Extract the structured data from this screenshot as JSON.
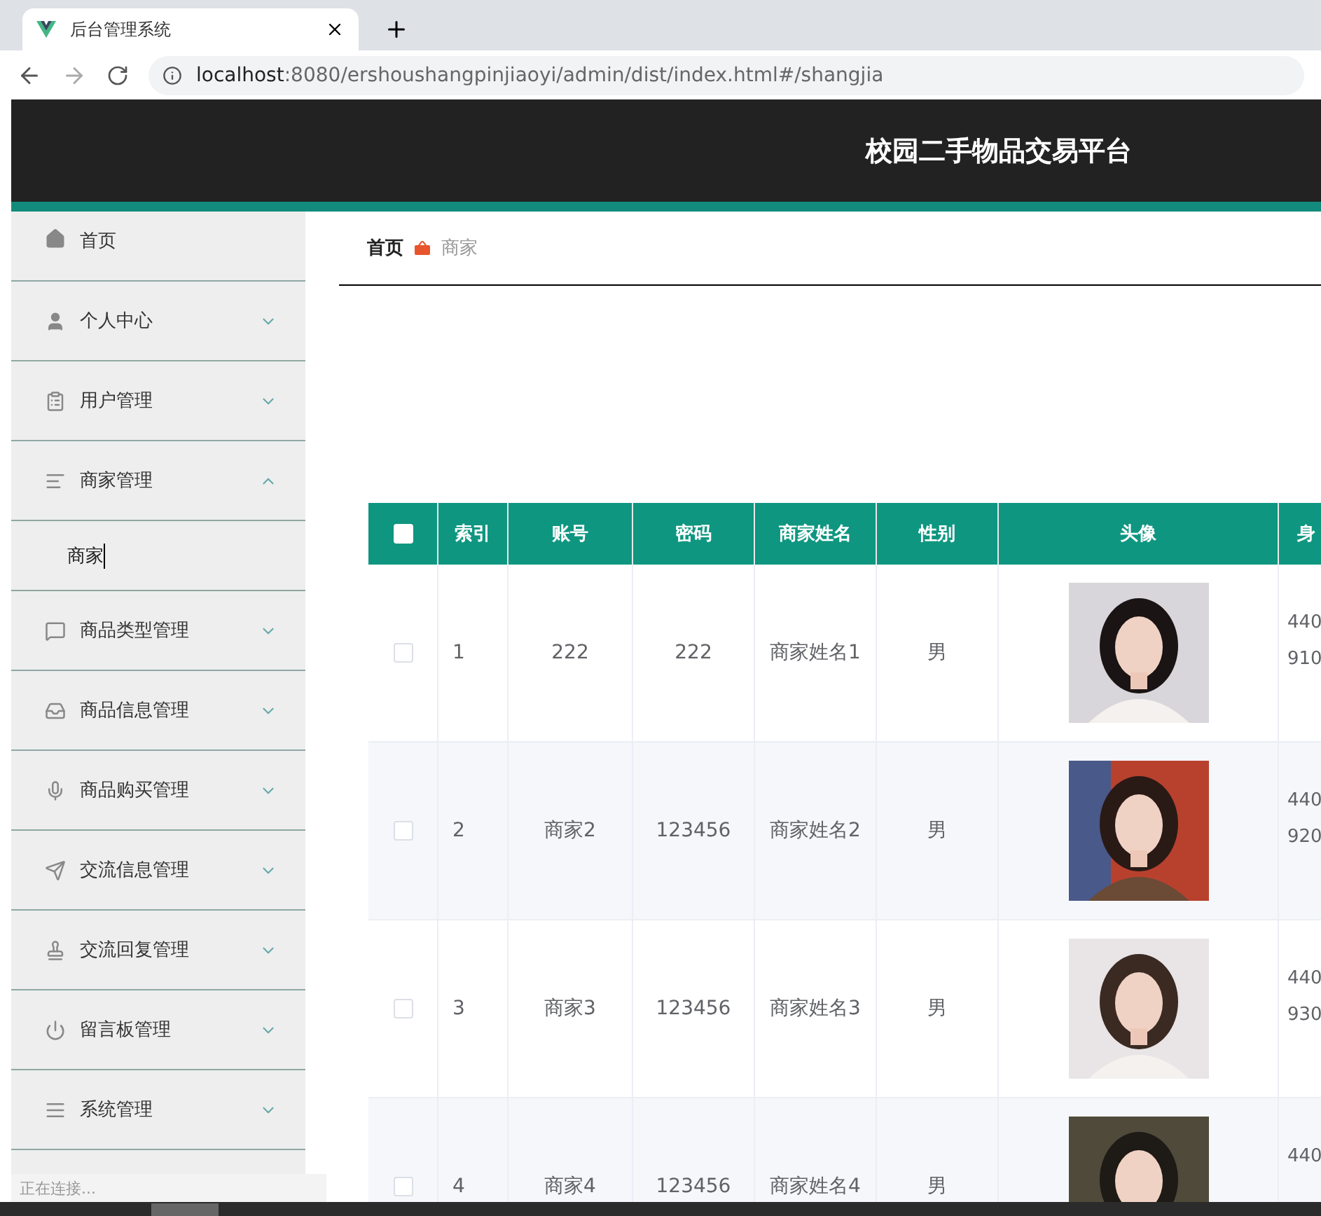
{
  "browser": {
    "tab_title": "后台管理系统",
    "url_host": "localhost",
    "url_rest": ":8080/ershoushangpinjiaoyi/admin/dist/index.html#/shangjia"
  },
  "header": {
    "title": "校园二手物品交易平台"
  },
  "sidebar": {
    "items": [
      {
        "label": "首页"
      },
      {
        "label": "个人中心",
        "expanded": false
      },
      {
        "label": "用户管理",
        "expanded": false
      },
      {
        "label": "商家管理",
        "expanded": true,
        "children": [
          {
            "label": "商家"
          }
        ]
      },
      {
        "label": "商品类型管理",
        "expanded": false
      },
      {
        "label": "商品信息管理",
        "expanded": false
      },
      {
        "label": "商品购买管理",
        "expanded": false
      },
      {
        "label": "交流信息管理",
        "expanded": false
      },
      {
        "label": "交流回复管理",
        "expanded": false
      },
      {
        "label": "留言板管理",
        "expanded": false
      },
      {
        "label": "系统管理",
        "expanded": false
      }
    ]
  },
  "breadcrumb": [
    "首页",
    "商家"
  ],
  "table": {
    "select_all": {
      "checked": false
    },
    "columns": [
      "索引",
      "账号",
      "密码",
      "商家姓名",
      "性别",
      "头像",
      "身"
    ],
    "rows": [
      {
        "cells": [
          "1",
          "222",
          "222",
          "商家姓名1",
          "男"
        ],
        "avatar": {
          "kind": "picture"
        },
        "column_7": [
          "440",
          "910"
        ],
        "checked": false
      },
      {
        "cells": [
          "2",
          "商家2",
          "123456",
          "商家姓名2",
          "男"
        ],
        "avatar": {
          "kind": "picture"
        },
        "column_7": [
          "440",
          "920"
        ],
        "checked": false
      },
      {
        "cells": [
          "3",
          "商家3",
          "123456",
          "商家姓名3",
          "男"
        ],
        "avatar": {
          "kind": "picture"
        },
        "column_7": [
          "440",
          "930"
        ],
        "checked": false
      },
      {
        "cells": [
          "4",
          "商家4",
          "123456",
          "商家姓名4",
          "男"
        ],
        "avatar": {
          "kind": "picture"
        },
        "column_7": [
          "440"
        ],
        "checked": false
      }
    ]
  },
  "status_bar": "正在连接..."
}
